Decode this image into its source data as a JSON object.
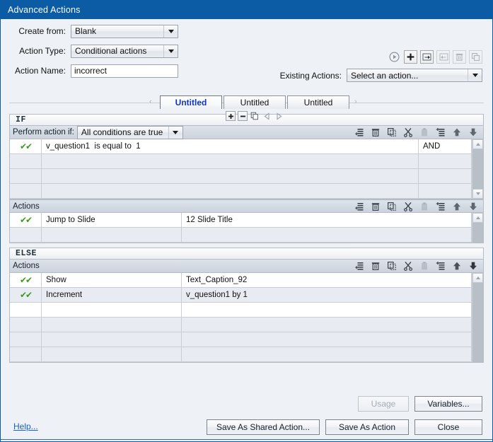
{
  "window": {
    "title": "Advanced Actions"
  },
  "form": {
    "create_from_label": "Create from:",
    "create_from_value": "Blank",
    "action_type_label": "Action Type:",
    "action_type_value": "Conditional actions",
    "action_name_label": "Action Name:",
    "action_name_value": "incorrect",
    "existing_actions_label": "Existing Actions:",
    "existing_actions_value": "Select an action..."
  },
  "top_toolbar": [
    {
      "name": "preview-icon",
      "glyph": "▶",
      "enabled": true
    },
    {
      "name": "add-icon",
      "glyph": "✚",
      "enabled": true
    },
    {
      "name": "save-as-icon",
      "glyph": "◱",
      "enabled": true
    },
    {
      "name": "import-icon",
      "glyph": "◰",
      "enabled": false
    },
    {
      "name": "delete-icon",
      "glyph": "🗑",
      "enabled": false
    },
    {
      "name": "duplicate-icon",
      "glyph": "⧉",
      "enabled": false
    }
  ],
  "tabs": {
    "items": [
      {
        "label": "Untitled",
        "active": true
      },
      {
        "label": "Untitled",
        "active": false
      },
      {
        "label": "Untitled",
        "active": false
      }
    ],
    "scroll_left": "‹",
    "scroll_right": "›",
    "tools": [
      {
        "name": "add-tab-icon",
        "glyph": "＋",
        "boxed": true
      },
      {
        "name": "remove-tab-icon",
        "glyph": "－",
        "boxed": true
      },
      {
        "name": "duplicate-tab-icon",
        "glyph": "⧉",
        "boxed": false
      },
      {
        "name": "move-tab-left-icon",
        "glyph": "◁",
        "boxed": false
      },
      {
        "name": "move-tab-right-icon",
        "glyph": "▷",
        "boxed": false
      }
    ]
  },
  "row_tools": [
    {
      "name": "add-row-icon",
      "glyph": "≡",
      "enabled": true
    },
    {
      "name": "delete-row-icon",
      "glyph": "🗑",
      "enabled": true
    },
    {
      "name": "copy-row-icon",
      "glyph": "❐",
      "enabled": true
    },
    {
      "name": "cut-row-icon",
      "glyph": "✂",
      "enabled": true
    },
    {
      "name": "paste-row-icon",
      "glyph": "📋",
      "enabled": false
    },
    {
      "name": "insert-row-icon",
      "glyph": "≣",
      "enabled": true
    },
    {
      "name": "move-up-icon",
      "glyph": "⬆",
      "enabled": true
    },
    {
      "name": "move-down-icon",
      "glyph": "⬇",
      "enabled": true
    }
  ],
  "if_block": {
    "header": "IF",
    "perform_label": "Perform action if:",
    "perform_value": "All conditions are true",
    "conditions": [
      {
        "checked": true,
        "variable": "v_question1",
        "operator": "is equal to",
        "value": "1",
        "join": "AND"
      },
      {
        "checked": false,
        "variable": "",
        "operator": "",
        "value": "",
        "join": ""
      },
      {
        "checked": false,
        "variable": "",
        "operator": "",
        "value": "",
        "join": ""
      },
      {
        "checked": false,
        "variable": "",
        "operator": "",
        "value": "",
        "join": ""
      }
    ],
    "actions_label": "Actions",
    "actions": [
      {
        "checked": true,
        "action": "Jump to Slide",
        "target": "12 Slide Title"
      },
      {
        "checked": false,
        "action": "",
        "target": ""
      }
    ]
  },
  "else_block": {
    "header": "ELSE",
    "actions_label": "Actions",
    "actions": [
      {
        "checked": true,
        "action": "Show",
        "target": "Text_Caption_92",
        "blank": false
      },
      {
        "checked": true,
        "action": "Increment",
        "target": "v_question1  by  1",
        "blank": false
      },
      {
        "checked": false,
        "action": "",
        "target": "",
        "blank": true
      },
      {
        "checked": false,
        "action": "",
        "target": "",
        "blank": false
      },
      {
        "checked": false,
        "action": "",
        "target": "",
        "blank": false
      },
      {
        "checked": false,
        "action": "",
        "target": "",
        "blank": false
      }
    ]
  },
  "footer": {
    "usage_label": "Usage",
    "variables_label": "Variables...",
    "save_shared_label": "Save As Shared Action...",
    "save_action_label": "Save As Action",
    "close_label": "Close",
    "help_label": "Help..."
  },
  "colors": {
    "title_bar": "#0b5ca5",
    "dialog_bg": "#eef1f5",
    "active_tab_text": "#0b33cc",
    "check_green": "#3a9a1f",
    "help_link": "#1a63c7"
  }
}
